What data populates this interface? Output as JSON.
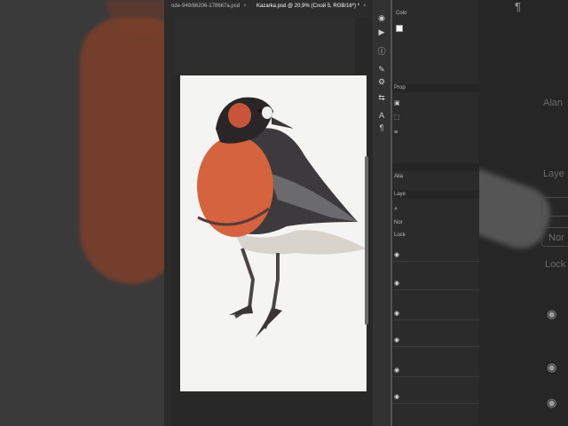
{
  "tabs": [
    {
      "label": "ode-949/86206-178667a.psd",
      "active": false
    },
    {
      "label": "Kazarka.psd @ 20,9% (Слой 5, RGB/16*) *",
      "active": true
    }
  ],
  "panels": {
    "color_label": "Colo",
    "properties_label": "Prop",
    "align_label": "Alia",
    "layers_label": "Laye",
    "lock_label": "Lock",
    "normal_label": "Nor",
    "right_ghost_align": "Alan",
    "right_ghost_layers": "Laye",
    "right_ghost_normal": "Nor",
    "right_ghost_lock": "Lock"
  },
  "icons": [
    "eye-icon",
    "play-icon",
    "info-icon",
    "brush-icon",
    "type-icon",
    "paragraph-icon"
  ],
  "accent_colors": {
    "bird_body": "#d4633e",
    "bird_dark": "#2a2628",
    "canvas": "#f4f4f2"
  }
}
